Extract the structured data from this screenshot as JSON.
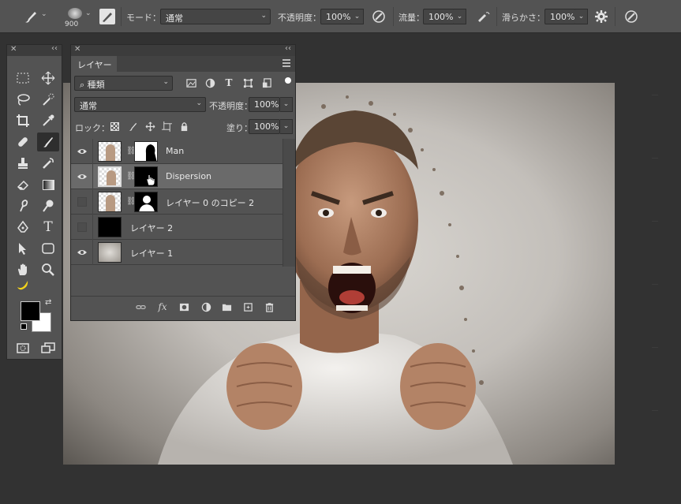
{
  "options_bar": {
    "brush_size": "900",
    "mode_label": "モード：",
    "mode_value": "通常",
    "opacity_label": "不透明度：",
    "opacity_value": "100%",
    "flow_label": "流量：",
    "flow_value": "100%",
    "smoothing_label": "滑らかさ：",
    "smoothing_value": "100%"
  },
  "layers_panel": {
    "tab_label": "レイヤー",
    "filter_value": "種類",
    "blend_mode": "通常",
    "opacity_label": "不透明度：",
    "opacity_value": "100%",
    "lock_label": "ロック：",
    "fill_label": "塗り：",
    "fill_value": "100%",
    "layers": [
      {
        "name": "Man",
        "visible": true,
        "selected": false
      },
      {
        "name": "Dispersion",
        "visible": true,
        "selected": true
      },
      {
        "name": "レイヤー 0 のコピー 2",
        "visible": false,
        "selected": false
      },
      {
        "name": "レイヤー 2",
        "visible": false,
        "selected": false
      },
      {
        "name": "レイヤー 1",
        "visible": true,
        "selected": false
      }
    ],
    "footer_icons": [
      "link-icon",
      "fx-icon",
      "mask-icon",
      "adjustment-icon",
      "folder-icon",
      "new-layer-icon",
      "trash-icon"
    ]
  },
  "tools_panel": {
    "tools": [
      "marquee-icon",
      "move-icon",
      "lasso-icon",
      "quick-select-icon",
      "crop-icon",
      "eyedropper-icon",
      "healing-icon",
      "brush-icon",
      "stamp-icon",
      "history-brush-icon",
      "eraser-icon",
      "gradient-icon",
      "smudge-icon",
      "dodge-icon",
      "pen-icon",
      "type-icon",
      "path-select-icon",
      "shape-icon",
      "hand-icon",
      "zoom-icon",
      "banana-icon"
    ],
    "foreground_color": "#000000",
    "background_color": "#ffffff"
  },
  "colors": {
    "ui_bg": "#323232",
    "panel": "#535353",
    "panel_dark": "#3c3c3c",
    "selected_row": "#6a6a6a"
  }
}
